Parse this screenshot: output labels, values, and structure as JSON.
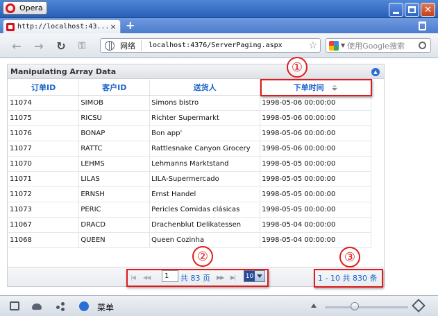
{
  "browser": {
    "menu_label": "Opera",
    "tab_title": "http://localhost:43...",
    "tab_close": "×",
    "new_tab": "+",
    "address_zone": "网络",
    "address_url": "localhost:4376/ServerPaging.aspx",
    "search_placeholder": "使用Google搜索",
    "status_menu_label": "菜单"
  },
  "grid": {
    "title": "Manipulating Array Data",
    "columns": [
      "订单ID",
      "客户ID",
      "送货人",
      "下单时间"
    ],
    "sort_column": "下单时间",
    "rows": [
      {
        "order_id": "11074",
        "customer_id": "SIMOB",
        "ship_name": "Simons bistro",
        "order_date": "1998-05-06 00:00:00"
      },
      {
        "order_id": "11075",
        "customer_id": "RICSU",
        "ship_name": "Richter Supermarkt",
        "order_date": "1998-05-06 00:00:00"
      },
      {
        "order_id": "11076",
        "customer_id": "BONAP",
        "ship_name": "Bon app'",
        "order_date": "1998-05-06 00:00:00"
      },
      {
        "order_id": "11077",
        "customer_id": "RATTC",
        "ship_name": "Rattlesnake Canyon Grocery",
        "order_date": "1998-05-06 00:00:00"
      },
      {
        "order_id": "11070",
        "customer_id": "LEHMS",
        "ship_name": "Lehmanns Marktstand",
        "order_date": "1998-05-05 00:00:00"
      },
      {
        "order_id": "11071",
        "customer_id": "LILAS",
        "ship_name": "LILA-Supermercado",
        "order_date": "1998-05-05 00:00:00"
      },
      {
        "order_id": "11072",
        "customer_id": "ERNSH",
        "ship_name": "Ernst Handel",
        "order_date": "1998-05-05 00:00:00"
      },
      {
        "order_id": "11073",
        "customer_id": "PERIC",
        "ship_name": "Pericles Comidas clásicas",
        "order_date": "1998-05-05 00:00:00"
      },
      {
        "order_id": "11067",
        "customer_id": "DRACD",
        "ship_name": "Drachenblut Delikatessen",
        "order_date": "1998-05-04 00:00:00"
      },
      {
        "order_id": "11068",
        "customer_id": "QUEEN",
        "ship_name": "Queen Cozinha",
        "order_date": "1998-05-04 00:00:00"
      }
    ]
  },
  "pager": {
    "current_page": "1",
    "total_pages_text": "共 83 页",
    "page_size": "10",
    "range_text": "1 - 10    共 830 条"
  },
  "annotations": [
    "①",
    "②",
    "③"
  ],
  "colors": {
    "header_text": "#1a62c9",
    "annotation": "#e01a1a"
  }
}
